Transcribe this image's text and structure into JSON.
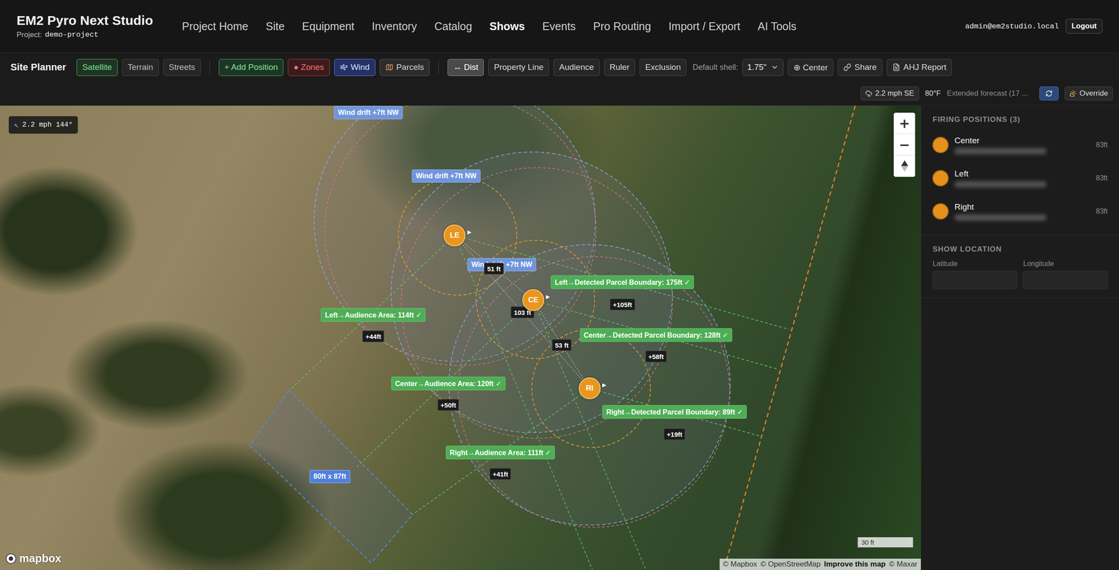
{
  "app": {
    "title": "EM2 Pyro Next Studio",
    "project_label": "Project:",
    "project": "demo-project"
  },
  "nav": [
    {
      "label": "Project Home",
      "selected": false
    },
    {
      "label": "Site",
      "selected": false
    },
    {
      "label": "Equipment",
      "selected": false
    },
    {
      "label": "Inventory",
      "selected": false
    },
    {
      "label": "Catalog",
      "selected": false
    },
    {
      "label": "Shows",
      "selected": true
    },
    {
      "label": "Events",
      "selected": false
    },
    {
      "label": "Pro Routing",
      "selected": false
    },
    {
      "label": "Import / Export",
      "selected": false
    },
    {
      "label": "AI Tools",
      "selected": false
    }
  ],
  "user": {
    "email": "admin@em2studio.local",
    "logout": "Logout"
  },
  "toolbar": {
    "title": "Site Planner",
    "basemaps": [
      {
        "label": "Satellite",
        "selected": true
      },
      {
        "label": "Terrain",
        "selected": false
      },
      {
        "label": "Streets",
        "selected": false
      }
    ],
    "layers": [
      {
        "label": "+ Add Position",
        "kind": "add"
      },
      {
        "label": "● Zones",
        "kind": "zones"
      },
      {
        "label": "Wind",
        "kind": "wind"
      },
      {
        "label": "Parcels",
        "kind": "parcels"
      }
    ],
    "measure": [
      {
        "label": "↔ Dist",
        "selected": true
      },
      {
        "label": "Property Line",
        "selected": false
      },
      {
        "label": "Audience",
        "selected": false
      },
      {
        "label": "Ruler",
        "selected": false
      },
      {
        "label": "Exclusion",
        "selected": false
      }
    ],
    "shell_label": "Default shell:",
    "shell_value": "1.75\"",
    "actions": [
      {
        "label": "⊕ Center",
        "kind": "center"
      },
      {
        "label": "Share",
        "kind": "share"
      },
      {
        "label": "AHJ Report",
        "kind": "report"
      }
    ]
  },
  "weather": {
    "wind": "2.2 mph SE",
    "temperature": "80°F",
    "forecast": "Extended forecast (17 ...",
    "override": "Override"
  },
  "map": {
    "wind_badge": {
      "arrow": "↖",
      "text": "2.2 mph 144°"
    },
    "zoom": {
      "in": "+",
      "out": "−"
    },
    "marker_glyph": "▸",
    "positions": [
      {
        "code": "LE"
      },
      {
        "code": "CE"
      },
      {
        "code": "RI"
      }
    ],
    "wind_drift": [
      "Wind drift +7ft NW",
      "Wind drift +7ft NW",
      "Wind drift +7ft NW"
    ],
    "spacings": [
      "51 ft",
      "103 ft",
      "53 ft"
    ],
    "clearances": [
      {
        "label": "Left→Audience Area: 114ft ✓",
        "margin": "+44ft"
      },
      {
        "label": "Left→Detected Parcel Boundary: 175ft ✓",
        "margin": "+105ft"
      },
      {
        "label": "Center→Detected Parcel Boundary: 128ft ✓",
        "margin": "+58ft"
      },
      {
        "label": "Center→Audience Area: 120ft ✓",
        "margin": "+50ft"
      },
      {
        "label": "Right→Detected Parcel Boundary: 89ft ✓",
        "margin": "+19ft"
      },
      {
        "label": "Right→Audience Area: 111ft ✓",
        "margin": "+41ft"
      }
    ],
    "audience_size": "80ft x 87ft",
    "scale": "30 ft",
    "logo": "mapbox",
    "attribution": [
      {
        "text": "© Mapbox",
        "bold": false
      },
      {
        "text": "© OpenStreetMap",
        "bold": false
      },
      {
        "text": "Improve this map",
        "bold": true
      },
      {
        "text": "© Maxar",
        "bold": false
      }
    ]
  },
  "sidebar": {
    "positions_title": "FIRING POSITIONS (3)",
    "positions": [
      {
        "name": "Center",
        "distance": "83ft"
      },
      {
        "name": "Left",
        "distance": "83ft"
      },
      {
        "name": "Right",
        "distance": "83ft"
      }
    ],
    "location_title": "SHOW LOCATION",
    "latitude": "Latitude",
    "longitude": "Longitude"
  }
}
